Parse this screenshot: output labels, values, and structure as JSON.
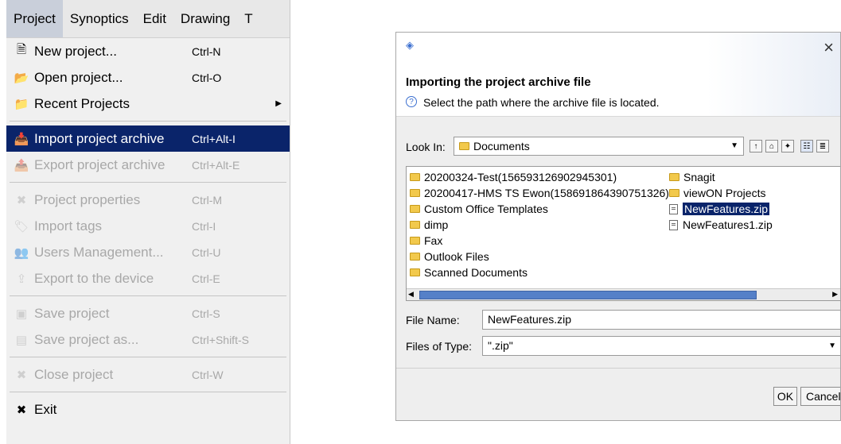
{
  "menubar": {
    "items": [
      "Project",
      "Synoptics",
      "Edit",
      "Drawing",
      "T"
    ]
  },
  "menu": {
    "groups": [
      [
        {
          "label": "New project...",
          "shortcut": "Ctrl-N",
          "icon": "new-project-icon",
          "state": "normal"
        },
        {
          "label": "Open project...",
          "shortcut": "Ctrl-O",
          "icon": "open-folder-icon",
          "state": "normal"
        },
        {
          "label": "Recent Projects",
          "shortcut": "",
          "icon": "folder-icon",
          "state": "normal",
          "submenu": true
        }
      ],
      [
        {
          "label": "Import project archive",
          "shortcut": "Ctrl+Alt-I",
          "icon": "import-archive-icon",
          "state": "selected"
        },
        {
          "label": "Export project archive",
          "shortcut": "Ctrl+Alt-E",
          "icon": "export-archive-icon",
          "state": "disabled"
        }
      ],
      [
        {
          "label": "Project properties",
          "shortcut": "Ctrl-M",
          "icon": "tools-icon",
          "state": "disabled"
        },
        {
          "label": "Import tags",
          "shortcut": "Ctrl-I",
          "icon": "tag-icon",
          "state": "disabled"
        },
        {
          "label": "Users Management...",
          "shortcut": "Ctrl-U",
          "icon": "users-icon",
          "state": "disabled"
        },
        {
          "label": "Export to the device",
          "shortcut": "Ctrl-E",
          "icon": "export-device-icon",
          "state": "disabled"
        }
      ],
      [
        {
          "label": "Save project",
          "shortcut": "Ctrl-S",
          "icon": "save-icon",
          "state": "disabled"
        },
        {
          "label": "Save project as...",
          "shortcut": "Ctrl+Shift-S",
          "icon": "save-as-icon",
          "state": "disabled"
        }
      ],
      [
        {
          "label": "Close project",
          "shortcut": "Ctrl-W",
          "icon": "close-project-icon",
          "state": "disabled"
        }
      ],
      [
        {
          "label": "Exit",
          "shortcut": "",
          "icon": "exit-icon",
          "state": "normal"
        }
      ]
    ]
  },
  "dialog": {
    "heading": "Importing the project archive file",
    "subtitle": "Select the path where the archive file is located.",
    "close_glyph": "×",
    "look_in_label": "Look In:",
    "look_in_value": "Documents",
    "files_col1": [
      {
        "name": "20200324-Test(156593126902945301)",
        "type": "folder"
      },
      {
        "name": "20200417-HMS TS Ewon(158691864390751326)",
        "type": "folder"
      },
      {
        "name": "Custom Office Templates",
        "type": "folder"
      },
      {
        "name": "dimp",
        "type": "folder"
      },
      {
        "name": "Fax",
        "type": "folder"
      },
      {
        "name": "Outlook Files",
        "type": "folder"
      },
      {
        "name": "Scanned Documents",
        "type": "folder"
      }
    ],
    "files_col2": [
      {
        "name": "Snagit",
        "type": "folder",
        "selected": false
      },
      {
        "name": "viewON Projects",
        "type": "folder",
        "selected": false
      },
      {
        "name": "NewFeatures.zip",
        "type": "file",
        "selected": true
      },
      {
        "name": "NewFeatures1.zip",
        "type": "file",
        "selected": false
      }
    ],
    "file_name_label": "File Name:",
    "file_name_value": "NewFeatures.zip",
    "files_type_label": "Files of Type:",
    "files_type_value": "\".zip\"",
    "ok_label": "OK",
    "cancel_label": "Cancel",
    "colors": {
      "selection": "#0a246a",
      "scroll_thumb": "#5580c8",
      "folder": "#f2c94c"
    }
  }
}
